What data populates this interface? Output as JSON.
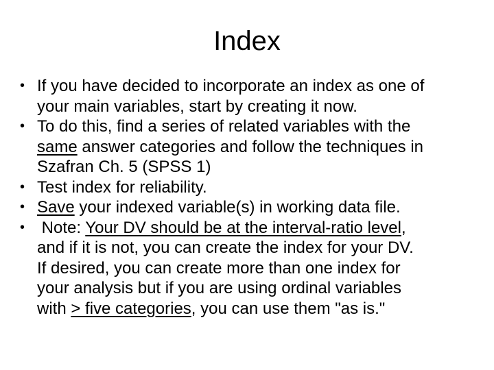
{
  "slide": {
    "title": "Index",
    "bullets": [
      {
        "lines": [
          "If you have decided to incorporate an index as one of",
          "your main variables, start by creating it now."
        ]
      },
      {
        "line1": "To do this, find a series of related variables with the",
        "line2_underlined": "same",
        "line2_rest": " answer categories and follow the techniques in",
        "line3": "Szafran Ch. 5 (SPSS 1)"
      },
      {
        "text": "Test index for reliability."
      },
      {
        "underlined": "Save",
        "rest": " your indexed variable(s) in working data file."
      },
      {
        "prefix": " Note: ",
        "underlined": "Your DV should be at the interval-ratio level",
        "suffix": ",",
        "line2": "and if it is not, you can create the index for your DV.",
        "line3": "If desired, you can create more than one index for",
        "line4": "your analysis but if you are using ordinal variables",
        "line5_prefix": "with ",
        "line5_underlined": "> five categories",
        "line5_suffix": ", you can use them \"as is.\""
      }
    ],
    "bullet_glyph": "•"
  }
}
